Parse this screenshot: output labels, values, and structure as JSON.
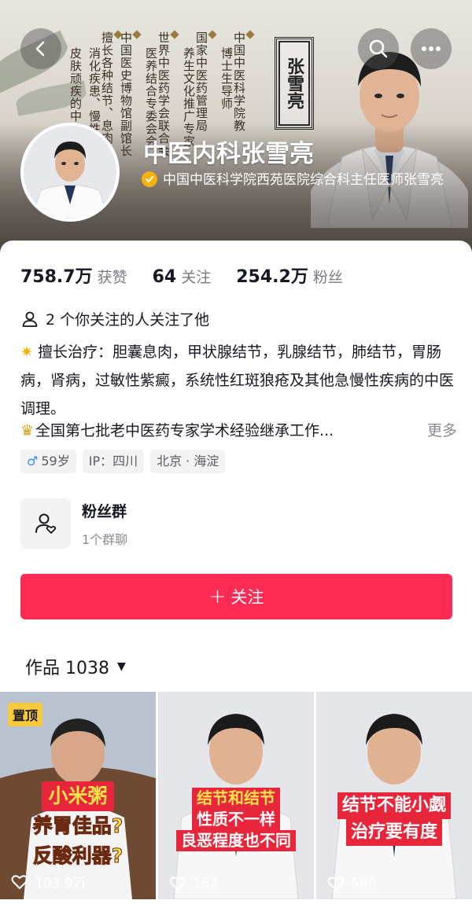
{
  "banner": {
    "columns": [
      "中国中医科学院教",
      "博士生导师",
      "国家中医药管理局",
      "养生文化推广专家",
      "世界中医药学会联合会",
      "医养结合专委会会",
      "中国医史博物馆副馆长",
      "擅长各种结节、息肉",
      "消化疾患、慢性",
      "皮肤顽疾的中医"
    ],
    "seal_text": "张雪亮"
  },
  "profile": {
    "name": "中医内科张雪亮",
    "verification": "中国中医科学院西苑医院综合科主任医师张雪亮"
  },
  "stats": [
    {
      "value": "758.7万",
      "label": "获赞"
    },
    {
      "value": "64",
      "label": "关注"
    },
    {
      "value": "254.2万",
      "label": "粉丝"
    }
  ],
  "follow_note": "2 个你关注的人关注了他",
  "bio": {
    "line1": "擅长治疗：胆囊息肉，甲状腺结节，乳腺结节，肺结节，胃肠病，肾病，过敏性紫癜，系统性红斑狼疮及其他急慢性疾病的中医调理。",
    "line2": "全国第七批老中医药专家学术经验继承工作...",
    "more": "更多"
  },
  "tags": {
    "gender_symbol": "♂",
    "age": "59岁",
    "ip": "IP：四川",
    "location": "北京 · 海淀"
  },
  "fan_group": {
    "title": "粉丝群",
    "subtitle": "1个群聊"
  },
  "follow_button": {
    "plus": "+",
    "label": "关注"
  },
  "works": {
    "title": "作品 1038",
    "caret": "▼"
  },
  "videos": [
    {
      "pinned": "置顶",
      "caption": [
        "小米粥",
        "养胃佳品?",
        "反酸利器?"
      ],
      "likes": "103.9万"
    },
    {
      "caption": [
        "结节和结节",
        "性质不一样",
        "良恶程度也不同"
      ],
      "likes": "182"
    },
    {
      "caption": [
        "结节不能小觑",
        "治疗要有度"
      ],
      "likes": "500"
    }
  ],
  "colors": {
    "accent": "#fe2c55",
    "verify_badge": "#f5b20b",
    "caption_yellow": "#ffe14a",
    "caption_red": "#e8263b"
  }
}
